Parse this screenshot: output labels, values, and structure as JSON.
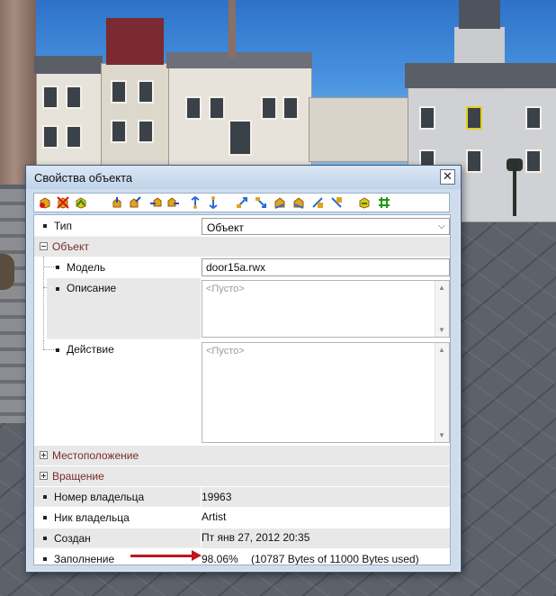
{
  "dialog": {
    "title": "Свойства объекта",
    "close_label": "✕"
  },
  "toolbar": {
    "icons": [
      "cube-add-icon",
      "cube-delete-icon",
      "cube-icon",
      "move-north-icon",
      "move-northeast-icon",
      "move-west-icon",
      "move-east-icon",
      "move-up-icon",
      "move-down-icon",
      "rotate-left-icon",
      "rotate-right-icon",
      "rotate-up-icon",
      "rotate-down-icon",
      "tilt-left-icon",
      "tilt-right-icon",
      "duplicate-icon",
      "snap-grid-icon"
    ]
  },
  "props": {
    "type_label": "Тип",
    "type_value": "Объект",
    "object_category": "Объект",
    "model_label": "Модель",
    "model_value": "door15a.rwx",
    "description_label": "Описание",
    "description_placeholder": "<Пусто>",
    "action_label": "Действие",
    "action_placeholder": "<Пусто>",
    "position_category": "Местоположение",
    "rotation_category": "Вращение",
    "owner_number_label": "Номер владельца",
    "owner_number_value": "19963",
    "owner_nick_label": "Ник владельца",
    "owner_nick_value": "Artist",
    "created_label": "Создан",
    "created_value": "Пт янв 27, 2012 20:35",
    "fill_label": "Заполнение",
    "fill_percent": "98.06%",
    "fill_detail": "(10787 Bytes of 11000 Bytes used)"
  },
  "colors": {
    "accent_arrow": "#c0141c",
    "category_text": "#7b2a2a",
    "dialog_bg": "#cfdcec"
  }
}
